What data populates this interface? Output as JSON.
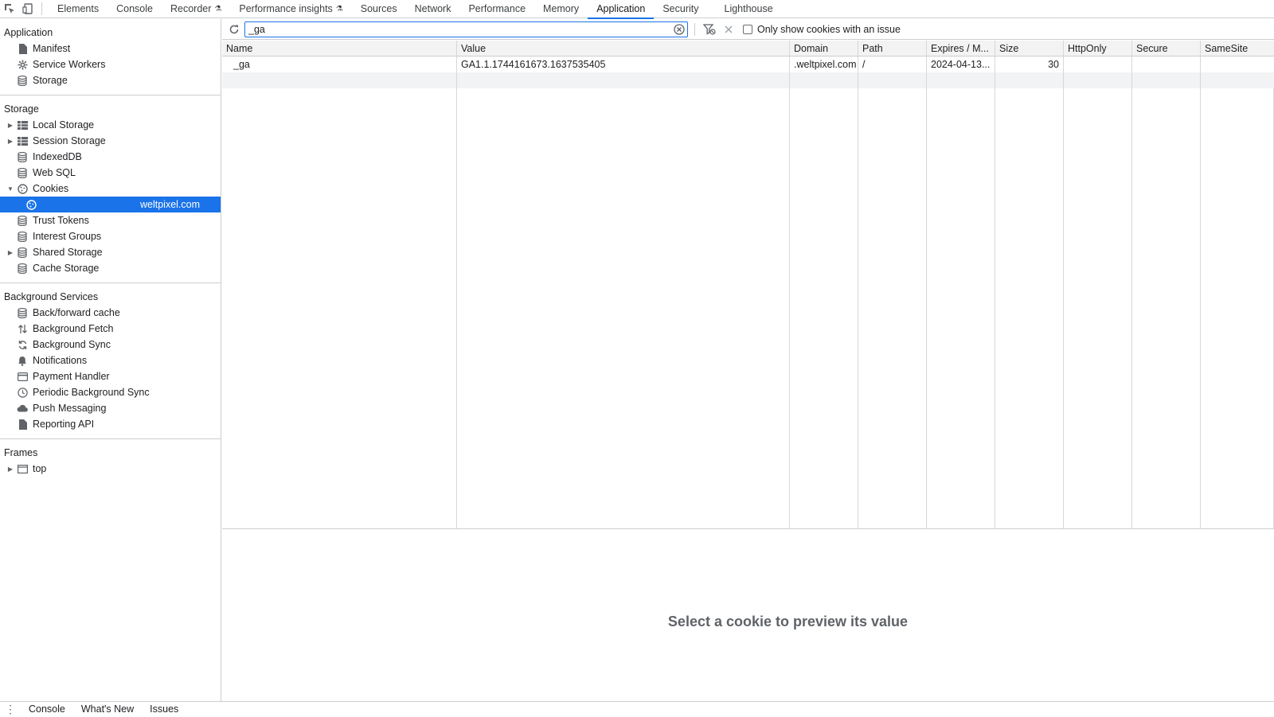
{
  "tabs": [
    {
      "label": "Elements"
    },
    {
      "label": "Console"
    },
    {
      "label": "Recorder",
      "flask": true
    },
    {
      "label": "Performance insights",
      "flask": true
    },
    {
      "label": "Sources"
    },
    {
      "label": "Network"
    },
    {
      "label": "Performance"
    },
    {
      "label": "Memory"
    },
    {
      "label": "Application",
      "active": true
    },
    {
      "label": "Security"
    },
    {
      "label": "Lighthouse"
    }
  ],
  "sidebar": {
    "application": {
      "title": "Application",
      "items": [
        {
          "label": "Manifest",
          "icon": "file-icon"
        },
        {
          "label": "Service Workers",
          "icon": "gear-icon"
        },
        {
          "label": "Storage",
          "icon": "database-icon"
        }
      ]
    },
    "storage": {
      "title": "Storage",
      "items": [
        {
          "label": "Local Storage",
          "icon": "table-icon",
          "expand": "right"
        },
        {
          "label": "Session Storage",
          "icon": "table-icon",
          "expand": "right"
        },
        {
          "label": "IndexedDB",
          "icon": "database-icon"
        },
        {
          "label": "Web SQL",
          "icon": "database-icon"
        },
        {
          "label": "Cookies",
          "icon": "cookie-icon",
          "expand": "down"
        },
        {
          "label": "weltpixel.com",
          "icon": "cookie-icon",
          "child": true,
          "selected": true
        },
        {
          "label": "Trust Tokens",
          "icon": "database-icon"
        },
        {
          "label": "Interest Groups",
          "icon": "database-icon"
        },
        {
          "label": "Shared Storage",
          "icon": "database-icon",
          "expand": "right"
        },
        {
          "label": "Cache Storage",
          "icon": "database-icon"
        }
      ]
    },
    "background": {
      "title": "Background Services",
      "items": [
        {
          "label": "Back/forward cache",
          "icon": "database-icon"
        },
        {
          "label": "Background Fetch",
          "icon": "arrows-icon"
        },
        {
          "label": "Background Sync",
          "icon": "sync-icon"
        },
        {
          "label": "Notifications",
          "icon": "bell-icon"
        },
        {
          "label": "Payment Handler",
          "icon": "card-icon"
        },
        {
          "label": "Periodic Background Sync",
          "icon": "clock-icon"
        },
        {
          "label": "Push Messaging",
          "icon": "cloud-icon"
        },
        {
          "label": "Reporting API",
          "icon": "file-icon"
        }
      ]
    },
    "frames": {
      "title": "Frames",
      "items": [
        {
          "label": "top",
          "icon": "frame-icon",
          "expand": "right"
        }
      ]
    }
  },
  "filter": {
    "value": "_ga",
    "only_issues_label": "Only show cookies with an issue"
  },
  "table": {
    "columns": [
      "Name",
      "Value",
      "Domain",
      "Path",
      "Expires / M...",
      "Size",
      "HttpOnly",
      "Secure",
      "SameSite"
    ],
    "rows": [
      [
        "_ga",
        "GA1.1.1744161673.1637535405",
        ".weltpixel.com",
        "/",
        "2024-04-13...",
        "30",
        "",
        "",
        ""
      ]
    ]
  },
  "preview": {
    "empty_text": "Select a cookie to preview its value"
  },
  "drawer": {
    "tabs": [
      "Console",
      "What's New",
      "Issues"
    ]
  }
}
